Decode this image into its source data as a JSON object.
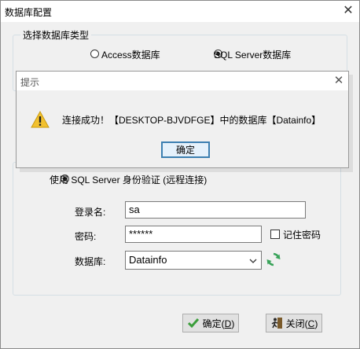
{
  "main_window": {
    "title": "数据库配置",
    "close_glyph": "✕"
  },
  "db_type": {
    "legend": "选择数据库类型",
    "options": [
      {
        "label": "Access数据库",
        "checked": false
      },
      {
        "label": "SQL Server数据库",
        "checked": true
      }
    ]
  },
  "auth": {
    "sql_auth_label": "使用 SQL Server 身份验证 (远程连接)",
    "login_label": "登录名:",
    "login_value": "sa",
    "password_label": "密码:",
    "password_value": "******",
    "remember_label": "记住密码",
    "remember_checked": false,
    "database_label": "数据库:",
    "database_value": "Datainfo",
    "refresh_icon": "refresh-icon"
  },
  "buttons": {
    "ok_label": "确定(",
    "ok_hotkey": "D",
    "ok_suffix": ")",
    "close_label": "关闭(",
    "close_hotkey": "C",
    "close_suffix": ")"
  },
  "dialog": {
    "title": "提示",
    "close_glyph": "✕",
    "message": "连接成功！【DESKTOP-BJVDFGE】中的数据库【Datainfo】",
    "ok_label": "确定",
    "icon": "warning-icon"
  },
  "colors": {
    "window_bg": "#f0f0f0",
    "warning_yellow": "#f2c12e",
    "refresh_green": "#3aa35a",
    "ok_check_green": "#3b9e3b",
    "focus_blue": "#3c7fb1"
  }
}
